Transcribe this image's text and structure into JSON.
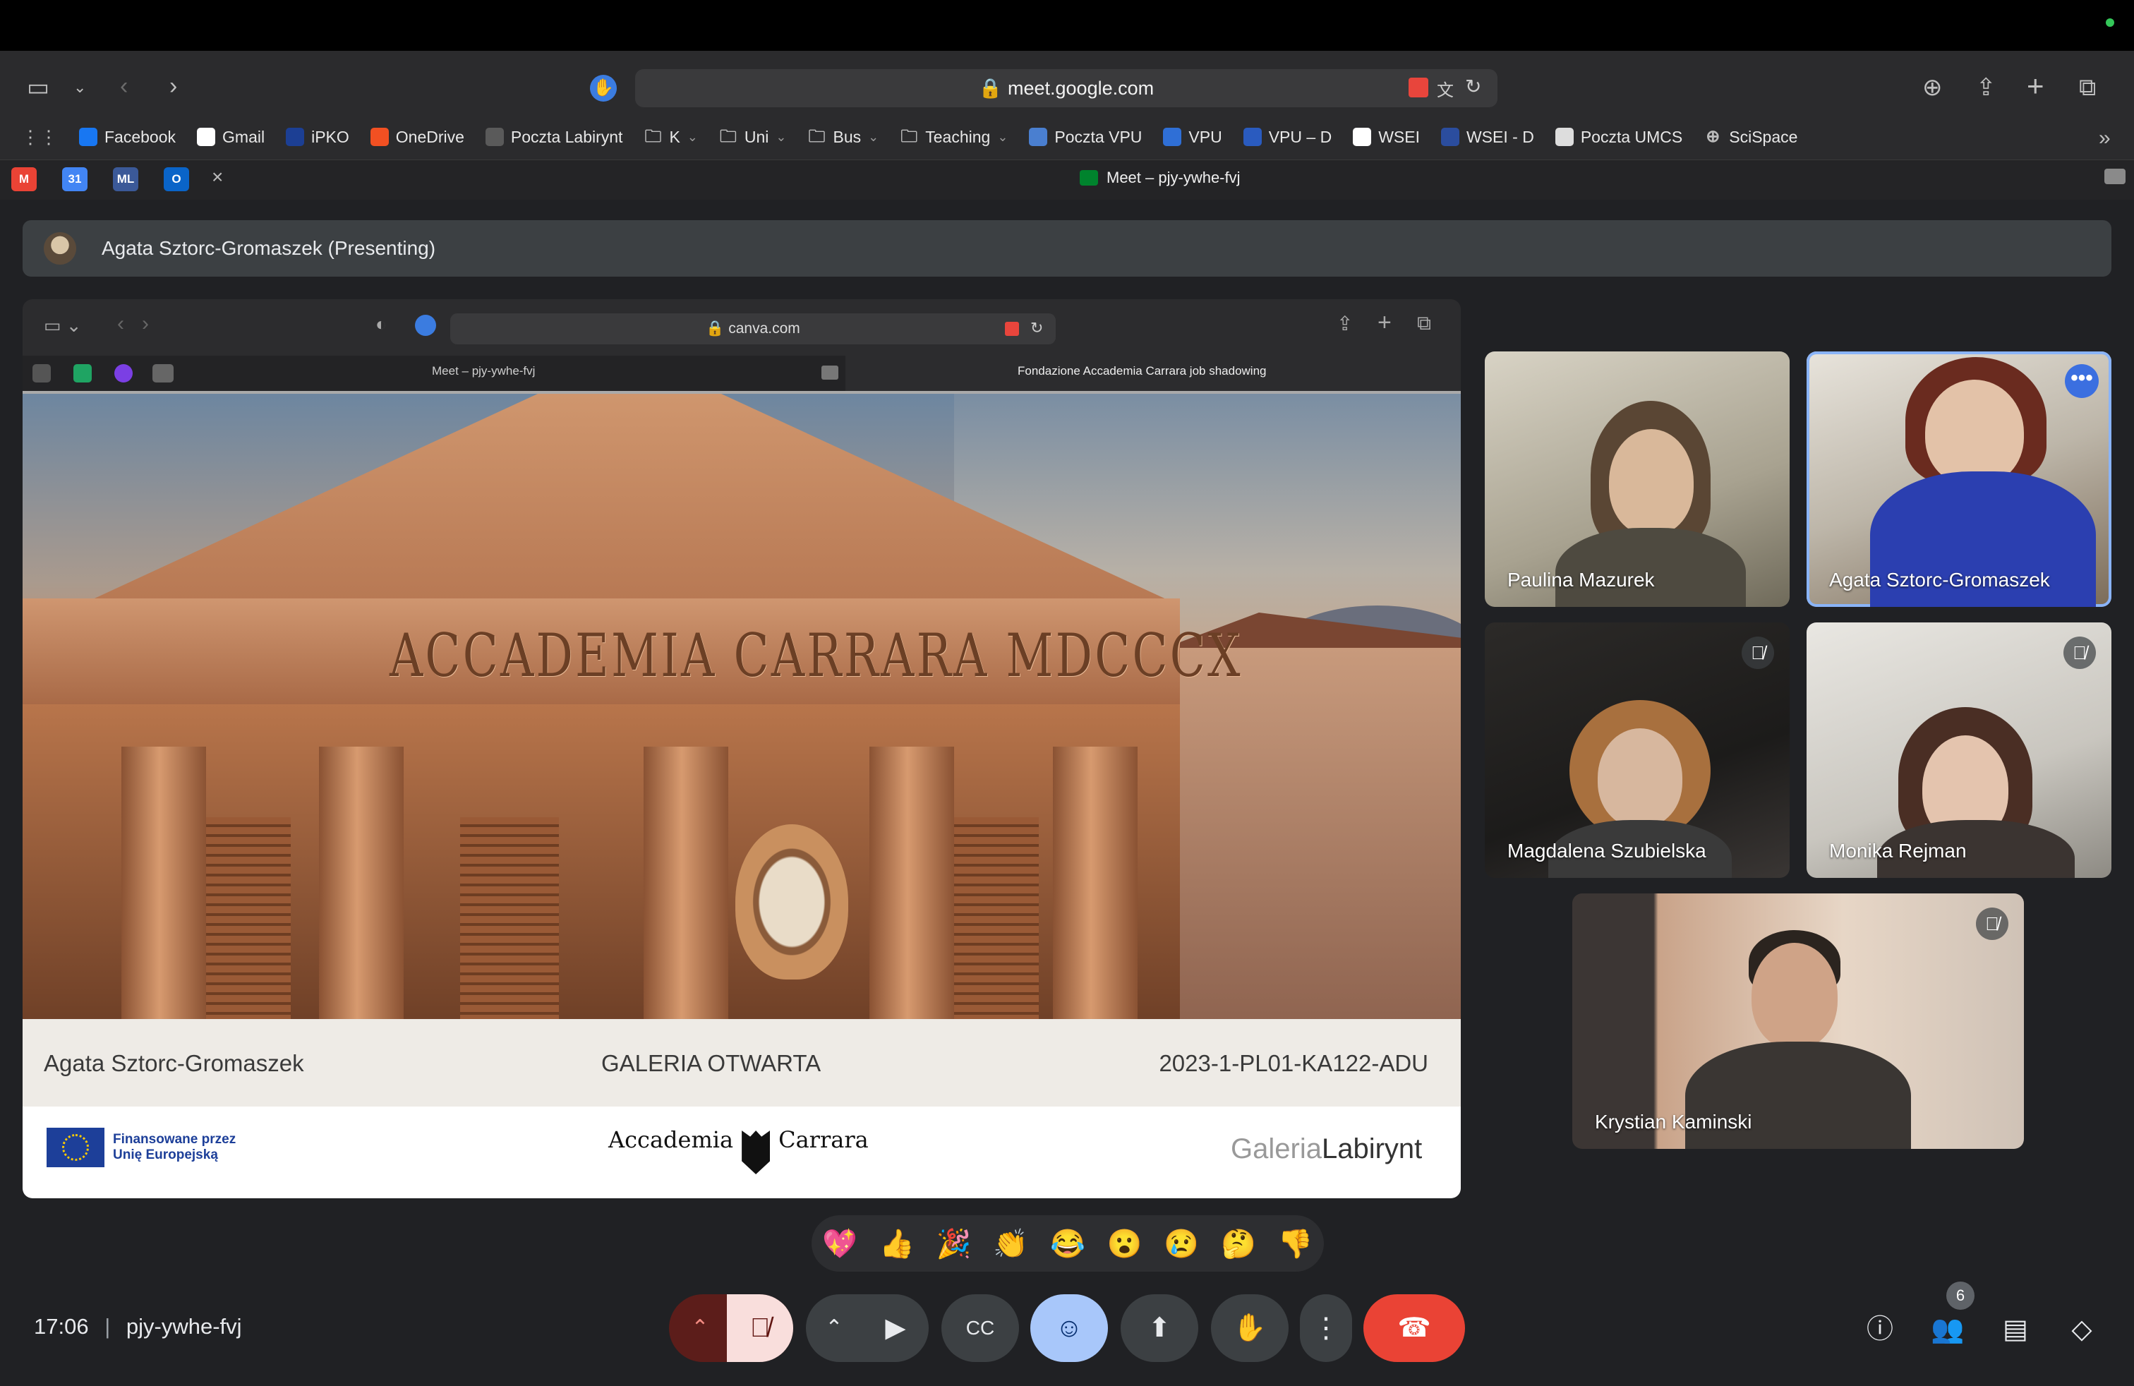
{
  "browser": {
    "url": "meet.google.com",
    "tab_title": "Meet – pjy-ywhe-fvj",
    "bookmarks": [
      {
        "label": "Facebook",
        "icon": "facebook-icon",
        "color": "#1877f2"
      },
      {
        "label": "Gmail",
        "icon": "google-icon",
        "color": "#ffffff"
      },
      {
        "label": "iPKO",
        "icon": "ipko-icon",
        "color": "#1c3f94"
      },
      {
        "label": "OneDrive",
        "icon": "windows-icon",
        "color": "#f25022"
      },
      {
        "label": "Poczta Labirynt",
        "icon": "ox-icon",
        "color": "#5a5a5a"
      },
      {
        "label": "K",
        "icon": "folder-icon"
      },
      {
        "label": "Uni",
        "icon": "folder-icon"
      },
      {
        "label": "Bus",
        "icon": "folder-icon"
      },
      {
        "label": "Teaching",
        "icon": "folder-icon"
      },
      {
        "label": "Poczta VPU",
        "icon": "mail-icon",
        "color": "#4a7fd0"
      },
      {
        "label": "VPU",
        "icon": "vpu-icon",
        "color": "#2f6fd6"
      },
      {
        "label": "VPU – D",
        "icon": "nd-icon",
        "color": "#2a5bbf"
      },
      {
        "label": "WSEI",
        "icon": "wsei-icon",
        "color": "#ffffff"
      },
      {
        "label": "WSEI - D",
        "icon": "wd-icon",
        "color": "#2b4d9e"
      },
      {
        "label": "Poczta UMCS",
        "icon": "umcs-icon",
        "color": "#dddddd"
      },
      {
        "label": "SciSpace",
        "icon": "globe-icon"
      }
    ],
    "pinned_tabs": [
      {
        "icon": "gmail-icon",
        "color": "#ea4335",
        "glyph": "M"
      },
      {
        "icon": "calendar-icon",
        "color": "#4285f4",
        "glyph": "31"
      },
      {
        "icon": "ml-icon",
        "color": "#3b5998",
        "glyph": "ML"
      },
      {
        "icon": "outlook-icon",
        "color": "#0a64c8",
        "glyph": "O"
      }
    ]
  },
  "presenting": {
    "label": "Agata Sztorc-Gromaszek (Presenting)"
  },
  "shared_screen": {
    "url": "canva.com",
    "tabs": [
      "Meet – pjy-ywhe-fvj",
      "Fondazione Accademia Carrara job shadowing"
    ],
    "inscription": "ACCADEMIA  CARRARA  MDCCCX",
    "caption_left": "Agata Sztorc-Gromaszek",
    "caption_center": "GALERIA OTWARTA",
    "caption_right": "2023-1-PL01-KA122-ADU",
    "eu_text": "Finansowane przez\nUnię Europejską",
    "accademia_left": "Accademia",
    "accademia_right": "Carrara",
    "galeria_light": "Galeria",
    "galeria_bold": "Labirynt"
  },
  "participants": [
    {
      "name": "Paulina Mazurek",
      "muted": false,
      "active": false
    },
    {
      "name": "Agata Sztorc-Gromaszek",
      "muted": false,
      "active": true
    },
    {
      "name": "Magdalena Szubielska",
      "muted": true,
      "active": false
    },
    {
      "name": "Monika Rejman",
      "muted": true,
      "active": false
    },
    {
      "name": "Krystian Kaminski",
      "muted": true,
      "active": false
    }
  ],
  "reactions": [
    "💖",
    "👍",
    "🎉",
    "👏",
    "😂",
    "😮",
    "😢",
    "🤔",
    "👎"
  ],
  "meeting": {
    "time": "17:06",
    "code": "pjy-ywhe-fvj",
    "participant_count": "6"
  },
  "colors": {
    "end_call": "#ea4335",
    "active_tile": "#8ab4f8",
    "emoji_button": "#a8c7fa",
    "mic_muted_bg": "#f9dedc"
  }
}
